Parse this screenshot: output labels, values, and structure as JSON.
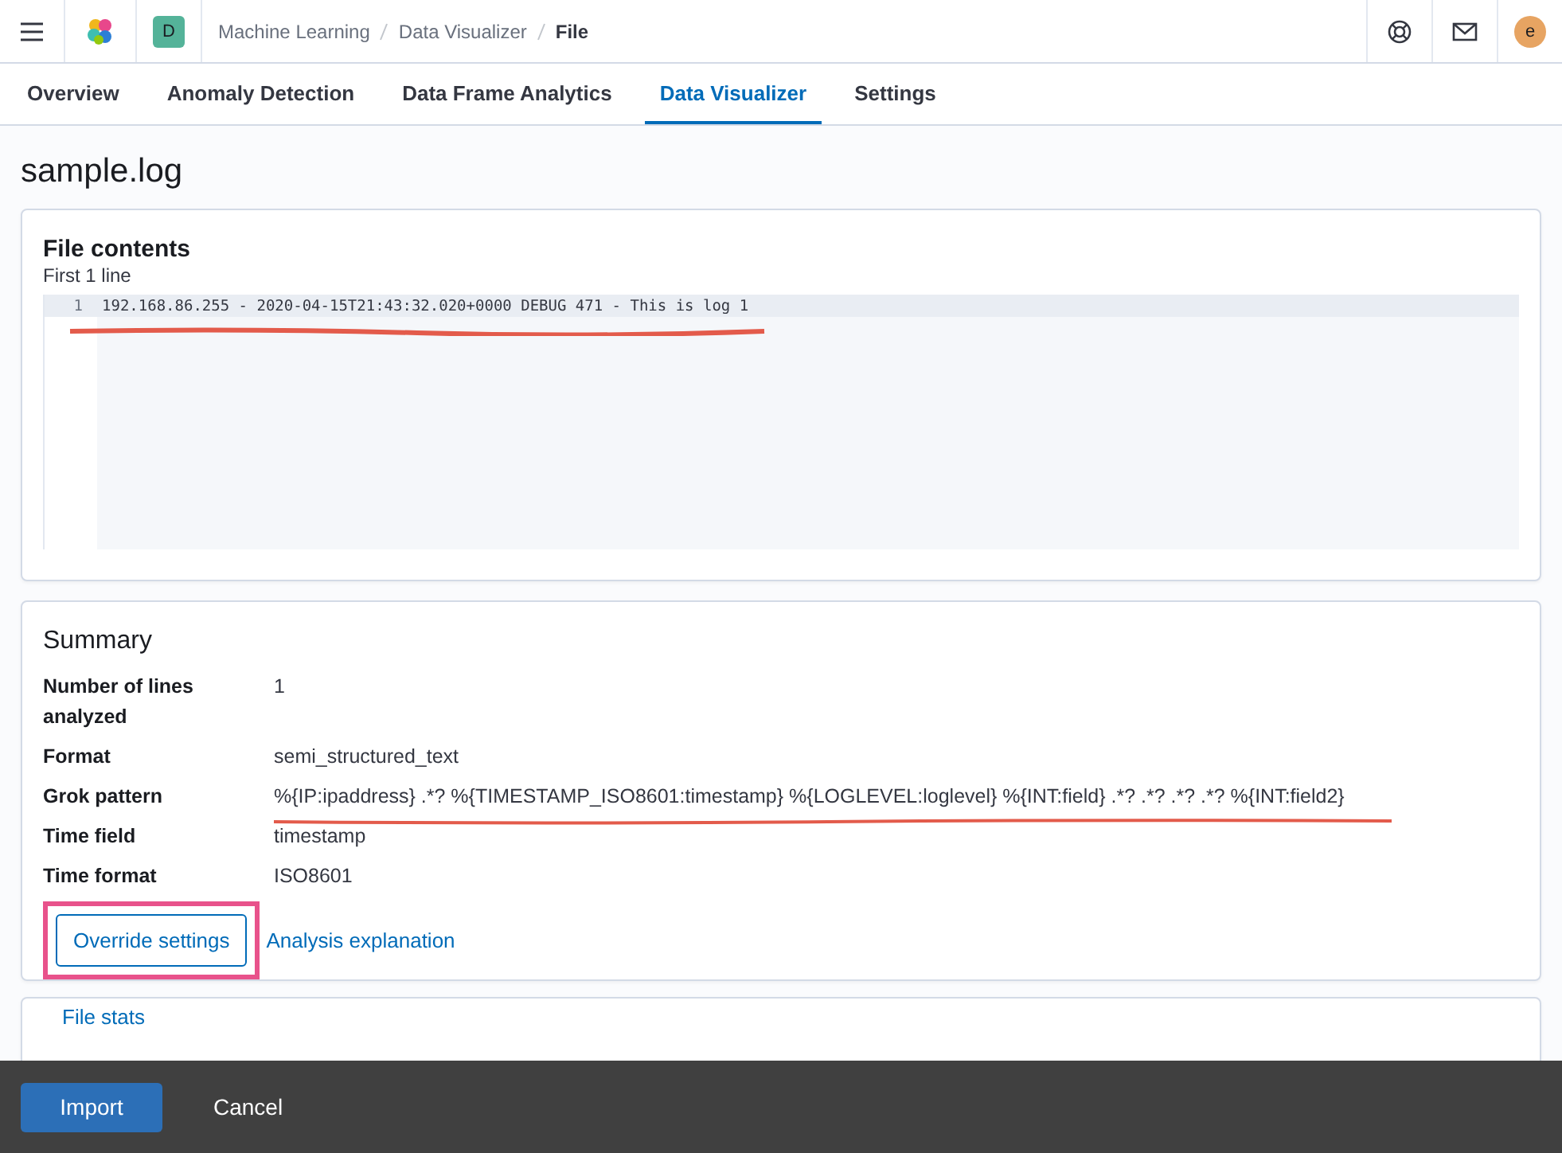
{
  "header": {
    "space_badge": "D",
    "breadcrumbs": [
      {
        "label": "Machine Learning",
        "current": false
      },
      {
        "label": "Data Visualizer",
        "current": false
      },
      {
        "label": "File",
        "current": true
      }
    ],
    "avatar": "e"
  },
  "tabs": [
    {
      "label": "Overview",
      "selected": false
    },
    {
      "label": "Anomaly Detection",
      "selected": false
    },
    {
      "label": "Data Frame Analytics",
      "selected": false
    },
    {
      "label": "Data Visualizer",
      "selected": true
    },
    {
      "label": "Settings",
      "selected": false
    }
  ],
  "page_title": "sample.log",
  "file_contents": {
    "title": "File contents",
    "subtitle": "First 1 line",
    "lines": [
      {
        "number": "1",
        "text": "192.168.86.255 - 2020-04-15T21:43:32.020+0000 DEBUG 471 - This is log 1"
      }
    ]
  },
  "summary": {
    "title": "Summary",
    "rows": [
      {
        "label": "Number of lines analyzed",
        "value": "1"
      },
      {
        "label": "Format",
        "value": "semi_structured_text"
      },
      {
        "label": "Grok pattern",
        "value": "%{IP:ipaddress} .*? %{TIMESTAMP_ISO8601:timestamp} %{LOGLEVEL:loglevel} %{INT:field} .*? .*? .*? .*? %{INT:field2}"
      },
      {
        "label": "Time field",
        "value": "timestamp"
      },
      {
        "label": "Time format",
        "value": "ISO8601"
      }
    ],
    "override_button": "Override settings",
    "explanation_link": "Analysis explanation"
  },
  "file_stats": {
    "title": "File stats"
  },
  "bottom_bar": {
    "import_button": "Import",
    "cancel_button": "Cancel"
  }
}
